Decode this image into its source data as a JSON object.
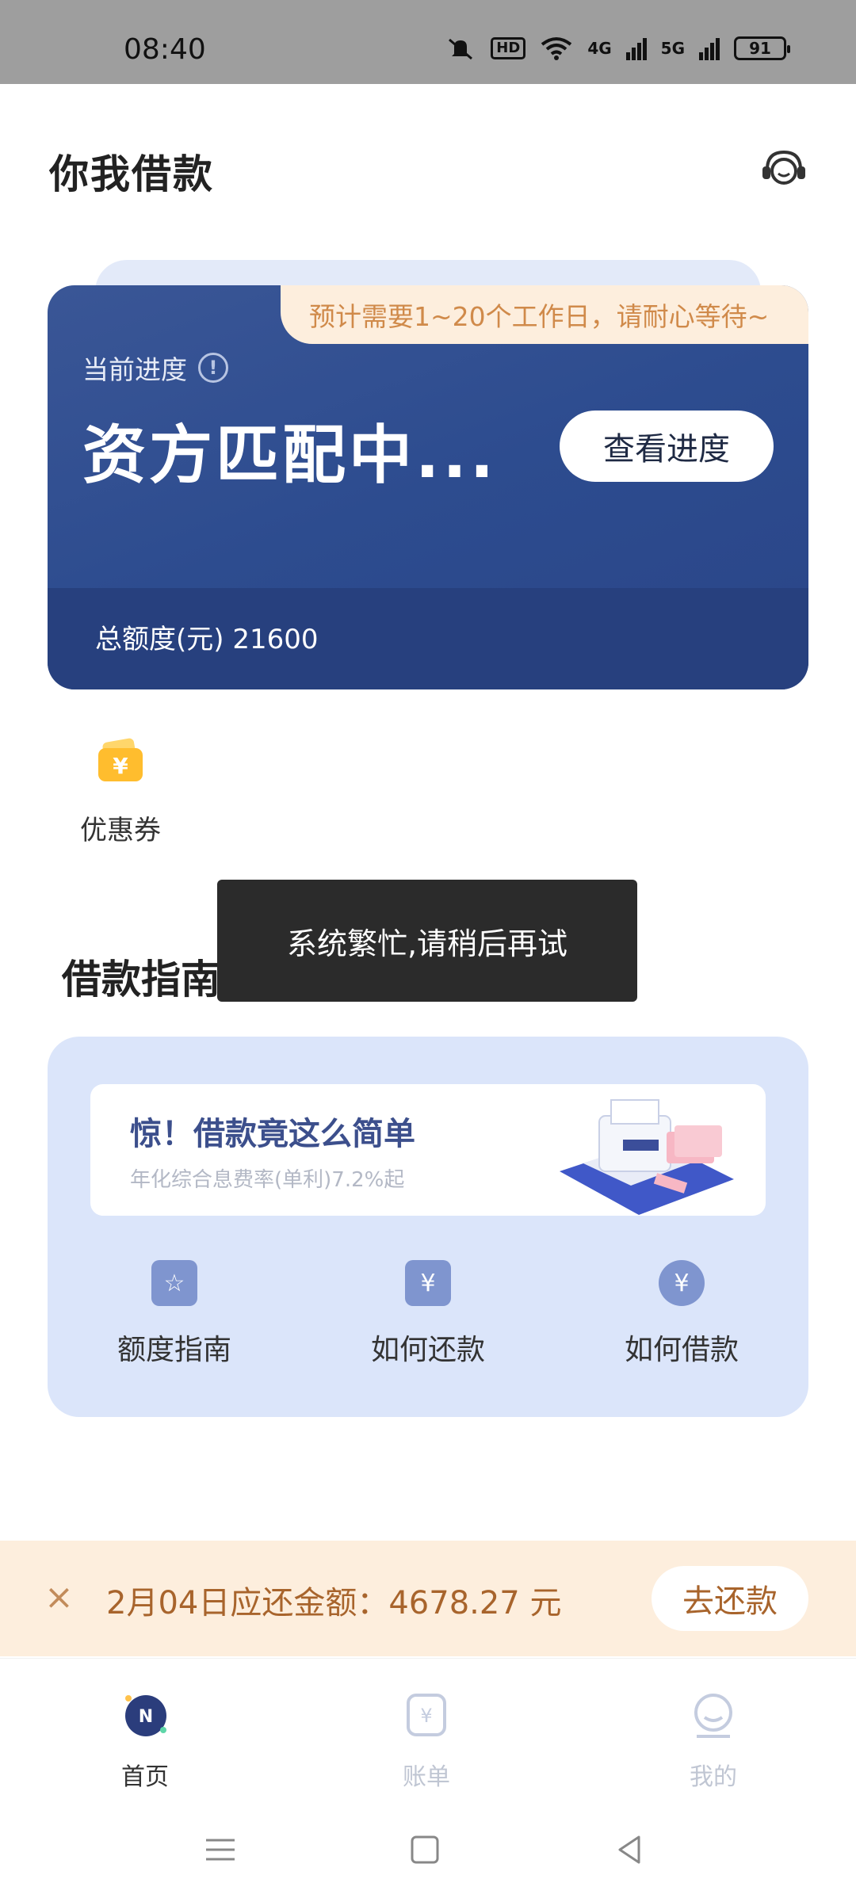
{
  "status_bar": {
    "time": "08:40",
    "hd_label": "HD",
    "net1": "4G",
    "net2": "5G",
    "battery": "91"
  },
  "header": {
    "title": "你我借款"
  },
  "progress_card": {
    "banner": "预计需要1~20个工作日，请耐心等待~",
    "label": "当前进度",
    "status": "资方匹配中...",
    "button": "查看进度",
    "limit_text": "总额度(元) 21600"
  },
  "coupon": {
    "label": "优惠券",
    "symbol": "¥"
  },
  "guide": {
    "title": "借款指南",
    "banner_headline": "惊！借款竟这么简单",
    "banner_sub": "年化综合息费率(单利)7.2%起",
    "items": [
      {
        "label": "额度指南",
        "icon": "star-icon"
      },
      {
        "label": "如何还款",
        "icon": "repay-icon"
      },
      {
        "label": "如何借款",
        "icon": "yuan-icon"
      }
    ]
  },
  "toast": {
    "message": "系统繁忙,请稍后再试"
  },
  "repay_bar": {
    "close": "×",
    "text": "2月04日应还金额：4678.27 元",
    "button": "去还款"
  },
  "tab_bar": {
    "tabs": [
      {
        "label": "首页",
        "active": true
      },
      {
        "label": "账单",
        "active": false
      },
      {
        "label": "我的",
        "active": false
      }
    ]
  },
  "colors": {
    "card_blue": "#2d4c8f",
    "banner_orange": "#d08a4a",
    "guide_bg": "#dbe5fa",
    "repay_bg": "#fdeedd"
  }
}
